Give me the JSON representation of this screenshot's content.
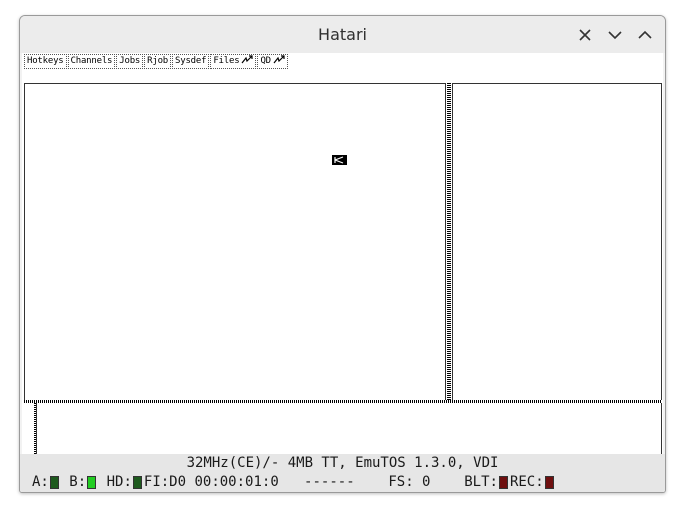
{
  "window": {
    "title": "Hatari",
    "close_icon": "close-icon",
    "minimize_icon": "chevron-down-icon",
    "maximize_icon": "chevron-up-icon"
  },
  "menubar": {
    "items": [
      {
        "label": "Hotkeys",
        "arrow": false
      },
      {
        "label": "Channels",
        "arrow": false
      },
      {
        "label": "Jobs",
        "arrow": false
      },
      {
        "label": "Rjob",
        "arrow": false
      },
      {
        "label": "Sysdef",
        "arrow": false
      },
      {
        "label": "Files",
        "arrow": true
      },
      {
        "label": "QD",
        "arrow": true
      }
    ]
  },
  "status": {
    "line1": "32MHz(CE)/- 4MB TT, EmuTOS 1.3.0, VDI",
    "a_label": "A:",
    "b_label": "B:",
    "hd_label": "HD:",
    "fi_label": "FI:D0 00:00:01:0",
    "dashes": "------",
    "fs_label": "FS: 0",
    "blt_label": "BLT:",
    "rec_label": "REC:",
    "colors": {
      "a_led": "#1e5a1e",
      "b_led": "#22cc22",
      "hd_led": "#1e5a1e",
      "blt_led": "#6e0f0f",
      "rec_led": "#6e0f0f"
    }
  }
}
